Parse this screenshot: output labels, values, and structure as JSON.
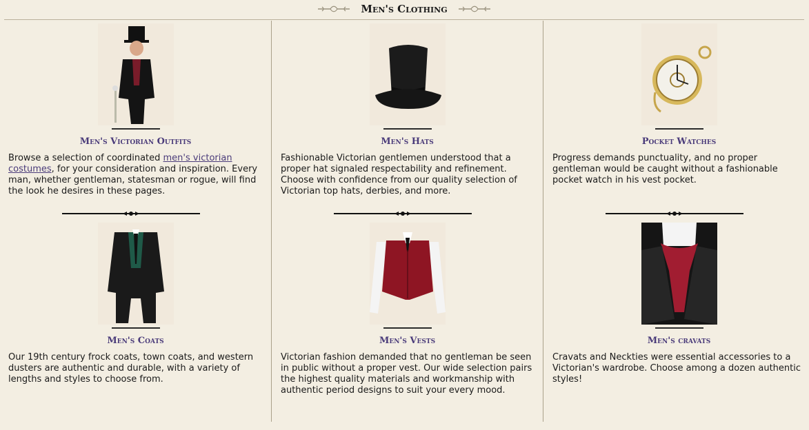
{
  "header": {
    "title": "Men's Clothing"
  },
  "cards": [
    {
      "name": "Men's Victorian Outfits",
      "desc_pre": "Browse a selection of coordinated ",
      "desc_link": "men's victorian costumes",
      "desc_post": ", for your consideration and inspiration. Every man, whether gentleman, statesman or rogue, will find the look he desires in these pages."
    },
    {
      "name": "Men's Hats",
      "desc": "Fashionable Victorian gentlemen understood that a proper hat signaled respectability and refinement. Choose with confidence from our quality selection of Victorian top hats, derbies, and more."
    },
    {
      "name": "Pocket Watches",
      "desc": "Progress demands punctuality, and no proper gentleman would be caught without a fashionable pocket watch in his vest pocket."
    },
    {
      "name": "Men's Coats",
      "desc": "Our 19th century frock coats, town coats, and western dusters are authentic and durable, with a variety of lengths and styles to choose from."
    },
    {
      "name": "Men's Vests",
      "desc": "Victorian fashion demanded that no gentleman be seen in public without a proper vest. Our wide selection pairs the highest quality materials and workmanship with authentic period designs to suit your every mood."
    },
    {
      "name": "Men's cravats",
      "desc": "Cravats and Neckties were essential accessories to a Victorian's wardrobe. Choose among a dozen authentic styles!"
    }
  ]
}
